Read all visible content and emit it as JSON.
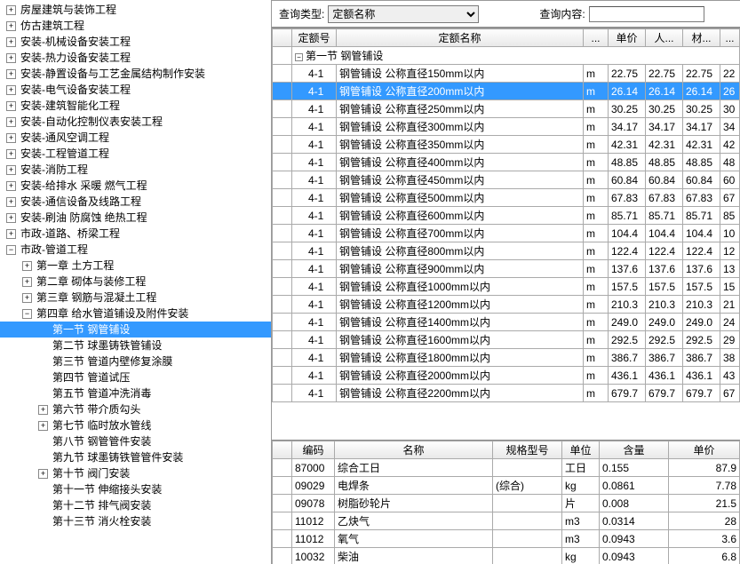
{
  "query": {
    "type_label": "查询类型:",
    "type_value": "定额名称",
    "content_label": "查询内容:",
    "content_value": ""
  },
  "tree": [
    {
      "lvl": 0,
      "exp": "+",
      "label": "房屋建筑与装饰工程"
    },
    {
      "lvl": 0,
      "exp": "+",
      "label": "仿古建筑工程"
    },
    {
      "lvl": 0,
      "exp": "+",
      "label": "安装-机械设备安装工程"
    },
    {
      "lvl": 0,
      "exp": "+",
      "label": "安装-热力设备安装工程"
    },
    {
      "lvl": 0,
      "exp": "+",
      "label": "安装-静置设备与工艺金属结构制作安装"
    },
    {
      "lvl": 0,
      "exp": "+",
      "label": "安装-电气设备安装工程"
    },
    {
      "lvl": 0,
      "exp": "+",
      "label": "安装-建筑智能化工程"
    },
    {
      "lvl": 0,
      "exp": "+",
      "label": "安装-自动化控制仪表安装工程"
    },
    {
      "lvl": 0,
      "exp": "+",
      "label": "安装-通风空调工程"
    },
    {
      "lvl": 0,
      "exp": "+",
      "label": "安装-工程管道工程"
    },
    {
      "lvl": 0,
      "exp": "+",
      "label": "安装-消防工程"
    },
    {
      "lvl": 0,
      "exp": "+",
      "label": "安装-给排水 采暖 燃气工程"
    },
    {
      "lvl": 0,
      "exp": "+",
      "label": "安装-通信设备及线路工程"
    },
    {
      "lvl": 0,
      "exp": "+",
      "label": "安装-刷油 防腐蚀 绝热工程"
    },
    {
      "lvl": 0,
      "exp": "+",
      "label": "市政-道路、桥梁工程"
    },
    {
      "lvl": 0,
      "exp": "−",
      "label": "市政-管道工程"
    },
    {
      "lvl": 1,
      "exp": "+",
      "label": "第一章 土方工程"
    },
    {
      "lvl": 1,
      "exp": "+",
      "label": "第二章 砌体与装修工程"
    },
    {
      "lvl": 1,
      "exp": "+",
      "label": "第三章 钢筋与混凝土工程"
    },
    {
      "lvl": 1,
      "exp": "−",
      "label": "第四章 给水管道铺设及附件安装"
    },
    {
      "lvl": 2,
      "exp": "",
      "label": "第一节 钢管铺设",
      "sel": true
    },
    {
      "lvl": 2,
      "exp": "",
      "label": "第二节 球墨铸铁管铺设"
    },
    {
      "lvl": 2,
      "exp": "",
      "label": "第三节 管道内壁修复涂膜"
    },
    {
      "lvl": 2,
      "exp": "",
      "label": "第四节 管道试压"
    },
    {
      "lvl": 2,
      "exp": "",
      "label": "第五节 管道冲洗消毒"
    },
    {
      "lvl": 2,
      "exp": "+",
      "label": "第六节 带介质勾头"
    },
    {
      "lvl": 2,
      "exp": "+",
      "label": "第七节 临时放水管线"
    },
    {
      "lvl": 2,
      "exp": "",
      "label": "第八节 钢管管件安装"
    },
    {
      "lvl": 2,
      "exp": "",
      "label": "第九节 球墨铸铁管管件安装"
    },
    {
      "lvl": 2,
      "exp": "+",
      "label": "第十节 阀门安装"
    },
    {
      "lvl": 2,
      "exp": "",
      "label": "第十一节 伸缩接头安装"
    },
    {
      "lvl": 2,
      "exp": "",
      "label": "第十二节 排气阀安装"
    },
    {
      "lvl": 2,
      "exp": "",
      "label": "第十三节 消火栓安装"
    }
  ],
  "grid1": {
    "headers": [
      "",
      "定额号",
      "定额名称",
      "...",
      "单价",
      "人...",
      "材...",
      "..."
    ],
    "section": "第一节 钢管铺设",
    "rows": [
      {
        "code": "4-1",
        "name": "钢管铺设  公称直径150mm以内",
        "u": "m",
        "p": "22.75",
        "r": "22.75",
        "c": "22.75",
        "x": "22"
      },
      {
        "code": "4-1",
        "name": "钢管铺设  公称直径200mm以内",
        "u": "m",
        "p": "26.14",
        "r": "26.14",
        "c": "26.14",
        "x": "26",
        "sel": true
      },
      {
        "code": "4-1",
        "name": "钢管铺设  公称直径250mm以内",
        "u": "m",
        "p": "30.25",
        "r": "30.25",
        "c": "30.25",
        "x": "30"
      },
      {
        "code": "4-1",
        "name": "钢管铺设  公称直径300mm以内",
        "u": "m",
        "p": "34.17",
        "r": "34.17",
        "c": "34.17",
        "x": "34"
      },
      {
        "code": "4-1",
        "name": "钢管铺设  公称直径350mm以内",
        "u": "m",
        "p": "42.31",
        "r": "42.31",
        "c": "42.31",
        "x": "42"
      },
      {
        "code": "4-1",
        "name": "钢管铺设  公称直径400mm以内",
        "u": "m",
        "p": "48.85",
        "r": "48.85",
        "c": "48.85",
        "x": "48"
      },
      {
        "code": "4-1",
        "name": "钢管铺设  公称直径450mm以内",
        "u": "m",
        "p": "60.84",
        "r": "60.84",
        "c": "60.84",
        "x": "60"
      },
      {
        "code": "4-1",
        "name": "钢管铺设  公称直径500mm以内",
        "u": "m",
        "p": "67.83",
        "r": "67.83",
        "c": "67.83",
        "x": "67"
      },
      {
        "code": "4-1",
        "name": "钢管铺设  公称直径600mm以内",
        "u": "m",
        "p": "85.71",
        "r": "85.71",
        "c": "85.71",
        "x": "85"
      },
      {
        "code": "4-1",
        "name": "钢管铺设  公称直径700mm以内",
        "u": "m",
        "p": "104.4",
        "r": "104.4",
        "c": "104.4",
        "x": "10"
      },
      {
        "code": "4-1",
        "name": "钢管铺设  公称直径800mm以内",
        "u": "m",
        "p": "122.4",
        "r": "122.4",
        "c": "122.4",
        "x": "12"
      },
      {
        "code": "4-1",
        "name": "钢管铺设  公称直径900mm以内",
        "u": "m",
        "p": "137.6",
        "r": "137.6",
        "c": "137.6",
        "x": "13"
      },
      {
        "code": "4-1",
        "name": "钢管铺设  公称直径1000mm以内",
        "u": "m",
        "p": "157.5",
        "r": "157.5",
        "c": "157.5",
        "x": "15"
      },
      {
        "code": "4-1",
        "name": "钢管铺设  公称直径1200mm以内",
        "u": "m",
        "p": "210.3",
        "r": "210.3",
        "c": "210.3",
        "x": "21"
      },
      {
        "code": "4-1",
        "name": "钢管铺设  公称直径1400mm以内",
        "u": "m",
        "p": "249.0",
        "r": "249.0",
        "c": "249.0",
        "x": "24"
      },
      {
        "code": "4-1",
        "name": "钢管铺设  公称直径1600mm以内",
        "u": "m",
        "p": "292.5",
        "r": "292.5",
        "c": "292.5",
        "x": "29"
      },
      {
        "code": "4-1",
        "name": "钢管铺设  公称直径1800mm以内",
        "u": "m",
        "p": "386.7",
        "r": "386.7",
        "c": "386.7",
        "x": "38"
      },
      {
        "code": "4-1",
        "name": "钢管铺设  公称直径2000mm以内",
        "u": "m",
        "p": "436.1",
        "r": "436.1",
        "c": "436.1",
        "x": "43"
      },
      {
        "code": "4-1",
        "name": "钢管铺设  公称直径2200mm以内",
        "u": "m",
        "p": "679.7",
        "r": "679.7",
        "c": "679.7",
        "x": "67"
      }
    ]
  },
  "grid2": {
    "headers": [
      "",
      "编码",
      "名称",
      "规格型号",
      "单位",
      "含量",
      "单价"
    ],
    "rows": [
      {
        "code": "87000",
        "name": "综合工日",
        "spec": "",
        "unit": "工日",
        "qty": "0.155",
        "price": "87.9"
      },
      {
        "code": "09029",
        "name": "电焊条",
        "spec": "(综合)",
        "unit": "kg",
        "qty": "0.0861",
        "price": "7.78"
      },
      {
        "code": "09078",
        "name": "树脂砂轮片",
        "spec": "",
        "unit": "片",
        "qty": "0.008",
        "price": "21.5"
      },
      {
        "code": "11012",
        "name": "乙炔气",
        "spec": "",
        "unit": "m3",
        "qty": "0.0314",
        "price": "28"
      },
      {
        "code": "11012",
        "name": "氧气",
        "spec": "",
        "unit": "m3",
        "qty": "0.0943",
        "price": "3.6"
      },
      {
        "code": "10032",
        "name": "柴油",
        "spec": "",
        "unit": "kg",
        "qty": "0.0943",
        "price": "6.8"
      }
    ]
  }
}
